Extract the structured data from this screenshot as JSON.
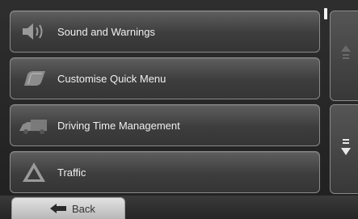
{
  "menu": {
    "items": [
      {
        "label": "Sound and Warnings",
        "icon": "speaker-icon"
      },
      {
        "label": "Customise Quick Menu",
        "icon": "quick-menu-icon"
      },
      {
        "label": "Driving Time Management",
        "icon": "truck-icon"
      },
      {
        "label": "Traffic",
        "icon": "traffic-warning-icon"
      }
    ]
  },
  "scroll": {
    "up_icon": "scroll-up-icon",
    "down_icon": "scroll-down-icon"
  },
  "footer": {
    "back_label": "Back",
    "back_icon": "back-arrow-icon"
  }
}
